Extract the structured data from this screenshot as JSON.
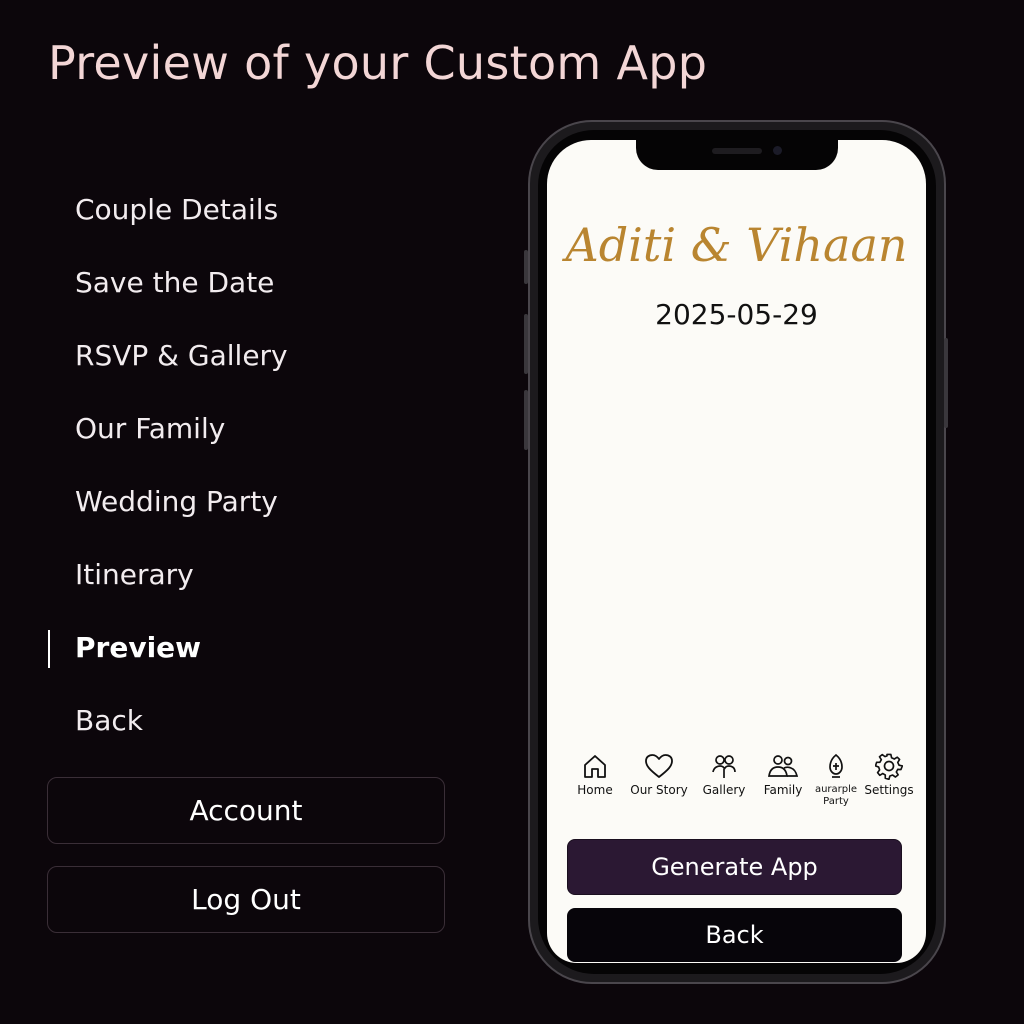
{
  "page": {
    "title": "Preview of your Custom App"
  },
  "nav": {
    "items": [
      {
        "label": "Couple Details"
      },
      {
        "label": "Save the Date"
      },
      {
        "label": "RSVP & Gallery"
      },
      {
        "label": "Our Family"
      },
      {
        "label": "Wedding Party"
      },
      {
        "label": "Itinerary"
      },
      {
        "label": "Preview",
        "active": true
      },
      {
        "label": "Back"
      }
    ],
    "account_label": "Account",
    "logout_label": "Log Out"
  },
  "preview": {
    "couple_names": "Aditi & Vihaan",
    "date": "2025-05-29",
    "tabs": [
      {
        "label": "Home",
        "icon": "home-icon"
      },
      {
        "label": "Our Story",
        "icon": "heart-icon"
      },
      {
        "label": "Gallery",
        "icon": "gallery-people-icon"
      },
      {
        "label": "Family",
        "icon": "family-icon"
      },
      {
        "label": "aurarple Party",
        "icon": "party-icon"
      },
      {
        "label": "Settings",
        "icon": "gear-icon"
      }
    ],
    "generate_label": "Generate App",
    "back_label": "Back"
  },
  "colors": {
    "background": "#0c060b",
    "title": "#f3d6d6",
    "names_gold": "#b98530",
    "screen_bg": "#fcfbf7",
    "generate_button": "#2b1833"
  }
}
